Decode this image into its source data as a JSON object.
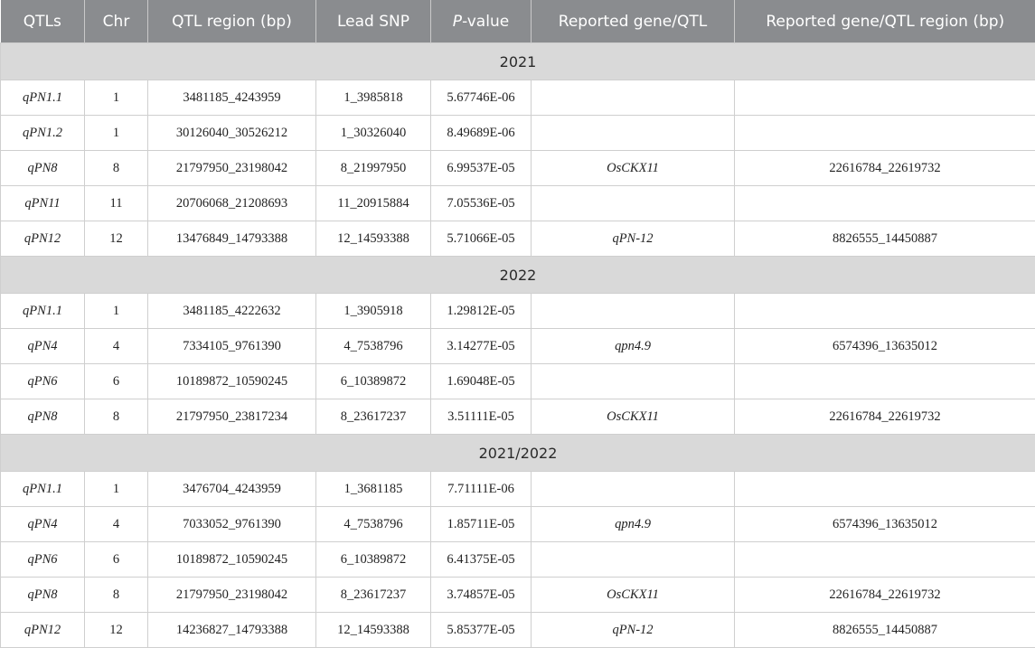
{
  "table": {
    "headers": {
      "qtls": "QTLs",
      "chr": "Chr",
      "region": "QTL region (bp)",
      "lead_snp": "Lead SNP",
      "pvalue_italic": "P",
      "pvalue_rest": "-value",
      "reported_gene": "Reported gene/QTL",
      "reported_region": "Reported gene/QTL region (bp)"
    },
    "groups": [
      {
        "label": "2021",
        "rows": [
          {
            "qtl": "qPN1.1",
            "chr": "1",
            "region": "3481185_4243959",
            "snp": "1_3985818",
            "p": "5.67746E-06",
            "gene": "",
            "gene_region": ""
          },
          {
            "qtl": "qPN1.2",
            "chr": "1",
            "region": "30126040_30526212",
            "snp": "1_30326040",
            "p": "8.49689E-06",
            "gene": "",
            "gene_region": ""
          },
          {
            "qtl": "qPN8",
            "chr": "8",
            "region": "21797950_23198042",
            "snp": "8_21997950",
            "p": "6.99537E-05",
            "gene": "OsCKX11",
            "gene_region": "22616784_22619732"
          },
          {
            "qtl": "qPN11",
            "chr": "11",
            "region": "20706068_21208693",
            "snp": "11_20915884",
            "p": "7.05536E-05",
            "gene": "",
            "gene_region": ""
          },
          {
            "qtl": "qPN12",
            "chr": "12",
            "region": "13476849_14793388",
            "snp": "12_14593388",
            "p": "5.71066E-05",
            "gene": "qPN-12",
            "gene_region": "8826555_14450887"
          }
        ]
      },
      {
        "label": "2022",
        "rows": [
          {
            "qtl": "qPN1.1",
            "chr": "1",
            "region": "3481185_4222632",
            "snp": "1_3905918",
            "p": "1.29812E-05",
            "gene": "",
            "gene_region": ""
          },
          {
            "qtl": "qPN4",
            "chr": "4",
            "region": "7334105_9761390",
            "snp": "4_7538796",
            "p": "3.14277E-05",
            "gene": "qpn4.9",
            "gene_region": "6574396_13635012"
          },
          {
            "qtl": "qPN6",
            "chr": "6",
            "region": "10189872_10590245",
            "snp": "6_10389872",
            "p": "1.69048E-05",
            "gene": "",
            "gene_region": ""
          },
          {
            "qtl": "qPN8",
            "chr": "8",
            "region": "21797950_23817234",
            "snp": "8_23617237",
            "p": "3.51111E-05",
            "gene": "OsCKX11",
            "gene_region": "22616784_22619732"
          }
        ]
      },
      {
        "label": "2021/2022",
        "rows": [
          {
            "qtl": "qPN1.1",
            "chr": "1",
            "region": "3476704_4243959",
            "snp": "1_3681185",
            "p": "7.71111E-06",
            "gene": "",
            "gene_region": ""
          },
          {
            "qtl": "qPN4",
            "chr": "4",
            "region": "7033052_9761390",
            "snp": "4_7538796",
            "p": "1.85711E-05",
            "gene": "qpn4.9",
            "gene_region": "6574396_13635012"
          },
          {
            "qtl": "qPN6",
            "chr": "6",
            "region": "10189872_10590245",
            "snp": "6_10389872",
            "p": "6.41375E-05",
            "gene": "",
            "gene_region": ""
          },
          {
            "qtl": "qPN8",
            "chr": "8",
            "region": "21797950_23198042",
            "snp": "8_23617237",
            "p": "3.74857E-05",
            "gene": "OsCKX11",
            "gene_region": "22616784_22619732"
          },
          {
            "qtl": "qPN12",
            "chr": "12",
            "region": "14236827_14793388",
            "snp": "12_14593388",
            "p": "5.85377E-05",
            "gene": "qPN-12",
            "gene_region": "8826555_14450887"
          }
        ]
      }
    ]
  }
}
